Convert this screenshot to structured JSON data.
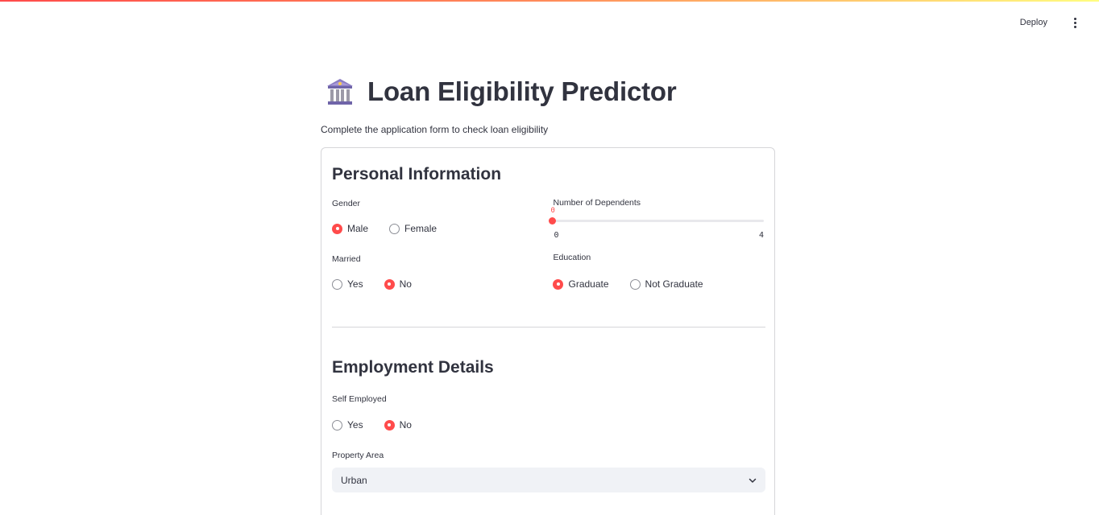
{
  "header": {
    "deploy_label": "Deploy",
    "menu_icon": "more-vertical-icon"
  },
  "page": {
    "icon": "bank-icon",
    "title": "Loan Eligibility Predictor",
    "subtitle": "Complete the application form to check loan eligibility"
  },
  "personal": {
    "title": "Personal Information",
    "gender": {
      "label": "Gender",
      "options": [
        "Male",
        "Female"
      ],
      "selected": "Male"
    },
    "married": {
      "label": "Married",
      "options": [
        "Yes",
        "No"
      ],
      "selected": "No"
    },
    "dependents": {
      "label": "Number of Dependents",
      "value": "0",
      "min": "0",
      "max": "4"
    },
    "education": {
      "label": "Education",
      "options": [
        "Graduate",
        "Not Graduate"
      ],
      "selected": "Graduate"
    }
  },
  "employment": {
    "title": "Employment Details",
    "self_employed": {
      "label": "Self Employed",
      "options": [
        "Yes",
        "No"
      ],
      "selected": "No"
    },
    "property_area": {
      "label": "Property Area",
      "value": "Urban"
    }
  },
  "colors": {
    "accent": "#ff4b4b",
    "text": "#31333f",
    "select_bg": "#f0f2f6",
    "border": "#d6d6d9"
  }
}
